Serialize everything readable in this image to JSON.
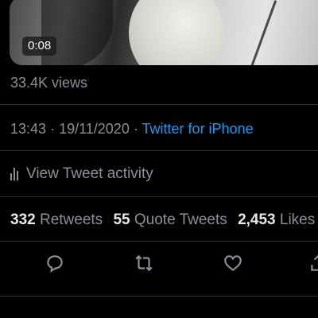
{
  "video": {
    "duration": "0:08"
  },
  "tweet": {
    "views": "33.4K views",
    "time": "13:43",
    "separator": "·",
    "date": "19/11/2020",
    "source": "Twitter for iPhone",
    "activity_label": "View Tweet activity"
  },
  "stats": {
    "retweets_count": "332",
    "retweets_label": "Retweets",
    "quotes_count": "55",
    "quotes_label": "Quote Tweets",
    "likes_count": "2,453",
    "likes_label": "Likes"
  },
  "actions": [
    "reply-icon",
    "retweet-icon",
    "like-icon",
    "share-icon"
  ],
  "colors": {
    "background": "#000000",
    "muted_text": "#8b9097",
    "link": "#1d9bf0",
    "primary_text": "#e7e9ea"
  }
}
